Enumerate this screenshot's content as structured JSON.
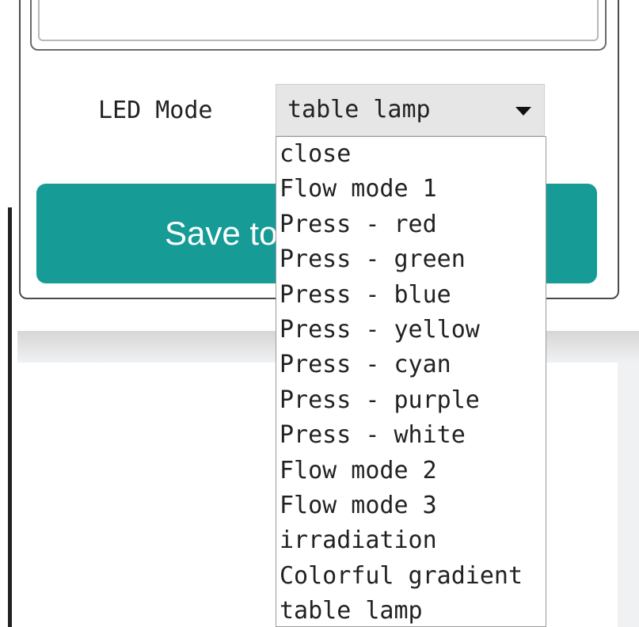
{
  "form": {
    "led_mode_label": "LED Mode",
    "led_mode_selected": "table lamp",
    "save_button_label": "Save to",
    "colors": {
      "save_button": "#169b96",
      "select_background": "#e6e6e6"
    }
  },
  "dropdown": {
    "options": [
      "close",
      "Flow mode 1",
      "Press - red",
      "Press - green",
      "Press - blue",
      "Press - yellow",
      "Press - cyan",
      "Press - purple",
      "Press - white",
      "Flow mode 2",
      "Flow mode 3",
      "irradiation",
      "Colorful gradient",
      "table lamp"
    ]
  },
  "icons": {
    "dropdown_arrow": "chevron-down-icon"
  }
}
